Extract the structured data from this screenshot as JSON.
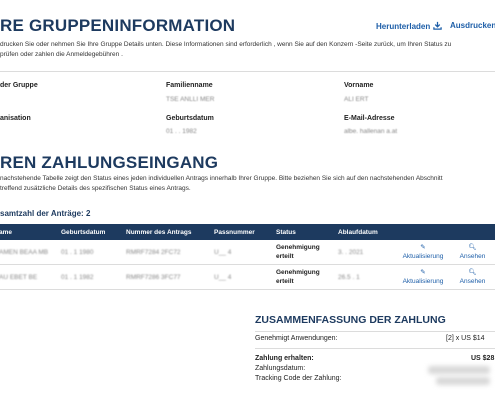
{
  "header": {
    "title": "RE GRUPPENINFORMATION",
    "download_label": "Herunterladen",
    "print_label": "Ausdrucken"
  },
  "intro": {
    "line1": "drucken Sie oder nehmen Sie Ihre Gruppe Details unten. Diese Informationen sind erforderlich , wenn Sie auf den Konzern -Seite zurück, um Ihren Status zu",
    "line2": "prüfen oder zahlen die Anmeldegebühren ."
  },
  "group_info": {
    "group_label": "der Gruppe",
    "group_value": "   ",
    "family_label": "Familienname",
    "family_value": "TSE  ANLLI  MER",
    "first_label": "Vorname",
    "first_value": "ALI  ERT",
    "org_label": "anisation",
    "org_value": "",
    "dob_label": "Geburtsdatum",
    "dob_value": "01 . . 1982",
    "email_label": "E-Mail-Adresse",
    "email_value": "albe.  hallenan  a.at"
  },
  "payment": {
    "title": "REN ZAHLUNGSEINGANG",
    "line1": "nachstehende Tabelle zeigt den Status eines jeden individuellen Antrags innerhalb Ihrer Gruppe. Bitte beziehen Sie sich auf den nachstehenden Abschnitt",
    "line2": "treffend zusätzliche Details des spezifischen Status eines Antrags.",
    "count_label": "samtzahl der Anträge: 2",
    "columns": [
      "ame",
      "Geburtsdatum",
      "Nummer des Antrags",
      "Passnummer",
      "Status",
      "Ablaufdatum",
      "",
      ""
    ],
    "rows": [
      {
        "name": "AMEN  BEAA  MB",
        "dob": "01 . 1 1980",
        "app_no": "RMRF7284  2FC72",
        "passport": "U__  4",
        "status1": "Genehmigung",
        "status2": "erteilt",
        "expiry": "3.  .  2021",
        "update": "Aktualisierung",
        "view": "Ansehen"
      },
      {
        "name": "AU  EBET  BE",
        "dob": "01 . 1 1982",
        "app_no": "RMRF7286  3FC77",
        "passport": "U__  4",
        "status1": "Genehmigung",
        "status2": "erteilt",
        "expiry": "26.5  .  1",
        "update": "Aktualisierung",
        "view": "Ansehen"
      }
    ]
  },
  "summary": {
    "title": "ZUSAMMENFASSUNG DER ZAHLUNG",
    "approved_label": "Genehmigt Anwendungen:",
    "approved_value": "[2] x US $14",
    "received_label": "Zahlung erhalten:",
    "received_value": "US $28",
    "date_label": "Zahlungsdatum:",
    "tracking_label": "Tracking Code der Zahlung:"
  },
  "colors": {
    "navy": "#1d3a5f",
    "link_blue": "#1d5ea8"
  }
}
